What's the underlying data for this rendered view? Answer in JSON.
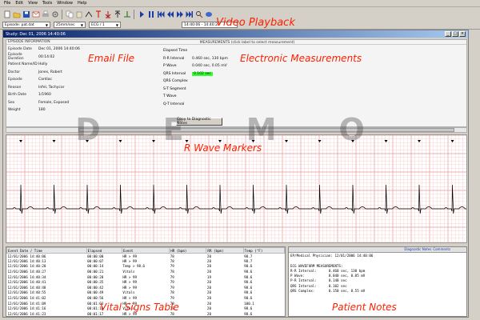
{
  "menu": [
    "File",
    "Edit",
    "View",
    "Tools",
    "Window",
    "Help"
  ],
  "combos": {
    "source": "Episode: pat.dat",
    "speed": "25mm/sec",
    "lead": "ECG / 1",
    "time": "14:40:06 - 14:40:20"
  },
  "window": {
    "title": "Study: Dec 01, 2006 14:40:06"
  },
  "info_header": "EPISODE INFORMATION",
  "fields": [
    {
      "label": "Episode Date",
      "value": "Dec 01, 2006 14:40:06"
    },
    {
      "label": "Episode Duration",
      "value": "00:14:02"
    },
    {
      "label": "Patient Name/ID",
      "value": "Holly"
    },
    {
      "label": "Doctor",
      "value": "Jones, Robert"
    },
    {
      "label": "Episode",
      "value": "Cardiac"
    },
    {
      "label": "Reason",
      "value": "Infel, Tachycar"
    },
    {
      "label": "Birth Date",
      "value": "1/1960"
    },
    {
      "label": "Sex",
      "value": "Female, Exposed"
    },
    {
      "label": "Weight",
      "value": "180"
    }
  ],
  "measure": {
    "title": "MEASUREMENTS (click label to select measurement)",
    "rows": [
      {
        "label": "Elapsed Time",
        "value": ""
      },
      {
        "label": "R-R Interval",
        "value": "0.460 sec, 130 bpm",
        "highlight": false
      },
      {
        "label": "P Wave",
        "value": "0.040 sec, 0.05 mV",
        "highlight": false
      },
      {
        "label": "QRS Interval",
        "value": "0.102 sec",
        "highlight": true
      },
      {
        "label": "QRS Complex",
        "value": "",
        "highlight": false
      },
      {
        "label": "S-T Segment",
        "value": "",
        "highlight": false
      },
      {
        "label": "T Wave",
        "value": "",
        "highlight": false
      },
      {
        "label": "Q-T Interval",
        "value": "",
        "highlight": false
      }
    ],
    "button": "Copy to Diagnostic Notes"
  },
  "watermark": "DEMO",
  "vitals": {
    "headers": [
      "Event Date / Time",
      "Elapsed",
      "Event",
      "HR (bpm)",
      "RR (bpm)",
      "Temp (°F)"
    ],
    "rows": [
      [
        "12/01/2006 14:40:06",
        "00:00:00",
        "HR > 99",
        "78",
        "20",
        "98.7"
      ],
      [
        "12/01/2006 14:40:13",
        "00:00:07",
        "HR > 99",
        "78",
        "20",
        "98.7"
      ],
      [
        "12/01/2006 14:40:20",
        "00:00:14",
        "Temp > 98.6",
        "79",
        "20",
        "98.6"
      ],
      [
        "12/01/2006 14:40:27",
        "00:00:21",
        "Vitals",
        "78",
        "20",
        "98.6"
      ],
      [
        "12/01/2006 14:40:34",
        "00:00:28",
        "HR > 99",
        "79",
        "19",
        "98.6"
      ],
      [
        "12/01/2006 14:40:41",
        "00:00:35",
        "HR > 99",
        "79",
        "20",
        "98.6"
      ],
      [
        "12/01/2006 14:40:48",
        "00:00:42",
        "HR > 99",
        "79",
        "20",
        "98.6"
      ],
      [
        "12/01/2006 14:40:55",
        "00:00:49",
        "Vitals",
        "78",
        "20",
        "98.6"
      ],
      [
        "12/01/2006 14:41:02",
        "00:00:56",
        "HR > 99",
        "79",
        "20",
        "98.6"
      ],
      [
        "12/01/2006 14:41:09",
        "00:01:03",
        "HR > 99",
        "78",
        "20",
        "100.1"
      ],
      [
        "12/01/2006 14:41:16",
        "00:01:10",
        "Vitals",
        "78",
        "20",
        "98.6"
      ],
      [
        "12/01/2006 14:41:23",
        "00:01:17",
        "HR > 99",
        "78",
        "20",
        "98.6"
      ]
    ]
  },
  "notes": {
    "tabs": [
      "Diagnostic Notes",
      "Comments"
    ],
    "lines": [
      "EP/Medical Physician: 12/01/2006 14:40:06",
      "",
      "ECG WAVEFORM MEASUREMENTS:",
      "R-R Interval:      0.460 sec, 130 bpm",
      "P Wave:            0.040 sec, 0.05 mV",
      "P-R Interval:      0.140 sec",
      "QRS Interval:      0.102 sec",
      "QRS Complex:       0.150 sec, 0.55 mV"
    ]
  },
  "annotations": {
    "video": "Video Playback",
    "email": "Email File",
    "measure": "Electronic Measurements",
    "rwave": "R Wave Markers",
    "vitals": "Vital Signs Table",
    "notes": "Patient Notes"
  },
  "colors": {
    "grid_minor": "#f7c8c8",
    "grid_major": "#e79898",
    "trace": "#000000",
    "annotation": "#ff2000"
  },
  "toolbar_icons": [
    "new-icon",
    "open-icon",
    "save-icon",
    "email-icon",
    "print-icon",
    "settings-icon",
    "copy-icon",
    "paste-icon",
    "caliper-icon",
    "marker-red-icon",
    "marker-down-icon",
    "marker-up-icon",
    "baseline-icon",
    "play-icon",
    "pause-icon",
    "skip-back-icon",
    "rewind-icon",
    "fast-forward-icon",
    "skip-forward-icon",
    "zoom-icon",
    "help-icon"
  ]
}
